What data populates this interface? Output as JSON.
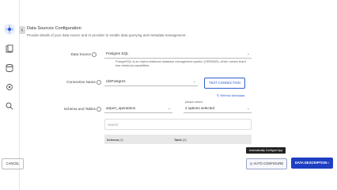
{
  "header": {
    "title": "Data Sources Configuration",
    "subtitle": "Provide details of your data source and AI provider to enable data querying and metadata management."
  },
  "form": {
    "data_source": {
      "label": "Data Source",
      "value": "Postgres SQL",
      "description": "PostgreSQL is an object-relational database management system (ORDBMS), which means that it has relational capabilities."
    },
    "connection": {
      "label": "Connection Name",
      "value": "rdsPostgres",
      "test_button": "TEST CONNECTION",
      "refresh_link": "Refresh Metadata"
    },
    "schema": {
      "label": "Schema and Tables",
      "value": "airport_operations",
      "tables_hint": "please select",
      "tables_value": "2 options selected"
    },
    "search": {
      "placeholder": "Search"
    },
    "table_header": {
      "schema_col": "Schema",
      "schema_count": "(1)",
      "table_col": "Table",
      "table_count": "(2)"
    }
  },
  "tooltip": {
    "text": "Automatically Configure App"
  },
  "footer": {
    "cancel": "CANCEL",
    "auto_configure": "AUTO CONFIGURE",
    "data_description": "DATA DESCRIPTION"
  }
}
